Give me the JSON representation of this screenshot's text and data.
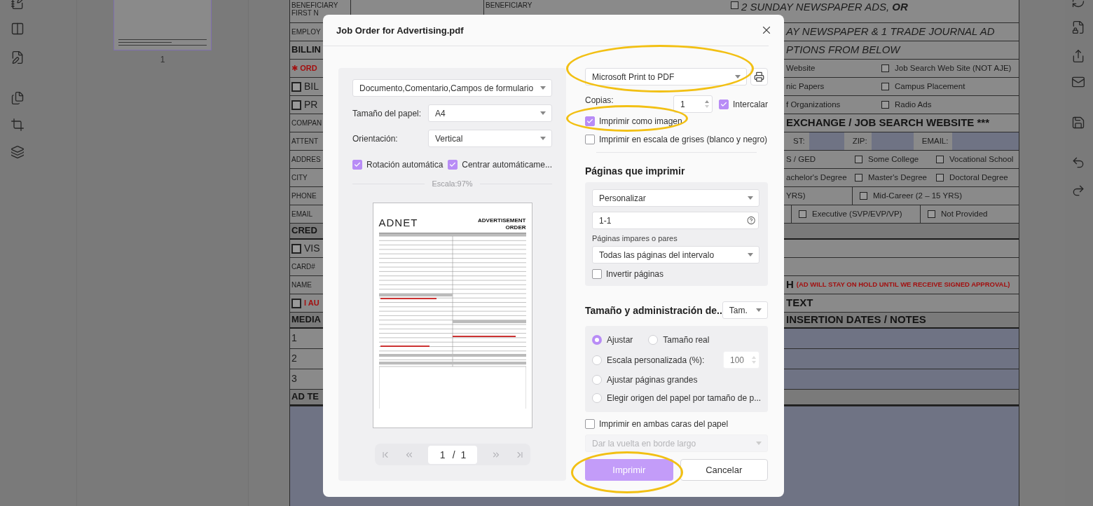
{
  "app": {
    "thumbnail_panel": {
      "page_label": "1",
      "selected": true
    },
    "document": {
      "rows": [
        {
          "kind": "top",
          "left": {
            "text": "BENEFICIARY FIRST N",
            "kind": "plain"
          },
          "middle": "BENEFICIARY",
          "right": [
            {
              "text": "2 SUNDAY NEWSPAPER ADS, **OR**",
              "kind": "italic",
              "checked": false
            }
          ]
        },
        {
          "kind": "lines",
          "left": {
            "text": "EMPLOY",
            "kind": "plain"
          },
          "right": [
            {
              "text": "AY NEWSPAPER & 1 TRADE JOURNAL AD",
              "kind": "italic"
            }
          ]
        },
        {
          "kind": "lines",
          "left": {
            "text": "BILLIN",
            "kind": "bold"
          },
          "right": [
            {
              "text": "PTIONS FROM BELOW",
              "kind": "italic"
            }
          ]
        },
        {
          "kind": "options2",
          "left": {
            "text": "✱ ORD",
            "kind": "alert"
          },
          "right": [
            {
              "text": "Website",
              "kind": "plain"
            },
            {
              "text": "Job Search Web Site (NOT AJE)",
              "kind": "plain",
              "checked": false
            }
          ]
        },
        {
          "kind": "options2",
          "left": {
            "text": "BIL",
            "kind": "large",
            "checked": false
          },
          "right": [
            {
              "text": "nic Papers",
              "kind": "plain"
            },
            {
              "text": "Campus Placement",
              "kind": "plain",
              "checked": false
            }
          ]
        },
        {
          "kind": "options2",
          "left": {
            "text": "PR",
            "kind": "large",
            "checked": false
          },
          "right": [
            {
              "text": "f Organizations",
              "kind": "plain"
            },
            {
              "text": "Radio Ads",
              "kind": "plain",
              "checked": false
            }
          ]
        },
        {
          "kind": "lines",
          "left": {
            "text": "COMPAN",
            "kind": "plain"
          },
          "right": [
            {
              "text": "EXCHANGE / JOB SEARCH WEBSITE ***",
              "kind": "bold"
            }
          ]
        },
        {
          "kind": "address",
          "left": {
            "text": "ATTENT",
            "kind": "plain"
          },
          "right": [
            {
              "text": "ST:",
              "kind": "plain"
            },
            {
              "text": "ZIP:",
              "kind": "plain"
            },
            {
              "text": "EMAIL:",
              "kind": "plain"
            }
          ]
        },
        {
          "kind": "options3",
          "left": {
            "text": "ADDRES",
            "kind": "plain"
          },
          "right": [
            {
              "text": "S / GED",
              "kind": "plain"
            },
            {
              "text": "Some College",
              "kind": "plain",
              "checked": false
            },
            {
              "text": "Vocational School",
              "kind": "plain",
              "checked": false
            }
          ]
        },
        {
          "kind": "options3",
          "left": {
            "text": "CITY",
            "kind": "plain"
          },
          "right": [
            {
              "text": "achelor's Degree",
              "kind": "plain"
            },
            {
              "text": "Master's Degree",
              "kind": "plain",
              "checked": false
            },
            {
              "text": "Doctoral Degree",
              "kind": "plain",
              "checked": false
            }
          ]
        },
        {
          "kind": "split",
          "left": {
            "text": "PHONE",
            "kind": "plain"
          },
          "right": [
            {
              "text": "YRS)",
              "kind": "plain"
            },
            {
              "text": "Mid-Career (2 – 15 YRS)",
              "kind": "plain",
              "checked": false
            }
          ]
        },
        {
          "kind": "split3",
          "left": {
            "text": "EMAIL",
            "kind": "plain"
          },
          "right": [
            {
              "text": "Executive (SVP/EVP/VP)",
              "kind": "plain",
              "checked": false
            },
            {
              "text": "Not Provided",
              "kind": "plain",
              "checked": false
            }
          ]
        },
        {
          "kind": "bar",
          "left": {
            "text": "CRED",
            "kind": "bold"
          }
        },
        {
          "kind": "lines",
          "left": {
            "text": "VIS",
            "kind": "large",
            "checked": false
          }
        },
        {
          "kind": "lines",
          "left": {
            "text": "CARD#",
            "kind": "plain"
          }
        },
        {
          "kind": "lines",
          "left": {
            "text": "NAME",
            "kind": "plain"
          },
          "right": [
            {
              "text": "H",
              "kind": "bold"
            },
            {
              "text": "(AD WILL STAY ON HOLD UNTIL WE RECEIVE SIGNED APPROVAL)",
              "kind": "alert"
            }
          ]
        },
        {
          "kind": "lines",
          "left": {
            "text": "I AU",
            "kind": "alert",
            "checked": false
          },
          "right": [
            {
              "text": "TEXT",
              "kind": "bold"
            }
          ]
        },
        {
          "kind": "bar",
          "left": {
            "text": "MEDIA",
            "kind": "bold"
          },
          "right": [
            {
              "text": "INSERTION DATES / NOTES",
              "kind": "bold"
            }
          ]
        },
        {
          "kind": "entry",
          "left": {
            "text": "1",
            "kind": "large"
          }
        },
        {
          "kind": "entry",
          "left": {
            "text": "2",
            "kind": "large"
          }
        },
        {
          "kind": "entry",
          "left": {
            "text": "3",
            "kind": "large"
          }
        },
        {
          "kind": "bar",
          "left": {
            "text": "AD TE",
            "kind": "bold"
          }
        }
      ]
    }
  },
  "dialog": {
    "title": "Job Order for Advertising.pdf",
    "content_select": "Documento,Comentario,Campos de formulario",
    "paper_size": {
      "label": "Tamaño del papel:",
      "value": "A4"
    },
    "orientation": {
      "label": "Orientación:",
      "value": "Vertical"
    },
    "layout_options": [
      {
        "label": "Rotación automática",
        "checked": true
      },
      {
        "label": "Centrar automáticame...",
        "checked": true
      }
    ],
    "scale_label": "Escala:97%",
    "preview": {
      "logo": "ADNET",
      "title": "ADVERTISEMENT ORDER"
    },
    "pager": {
      "current": "1",
      "separator": "/",
      "total": "1"
    },
    "printer": "Microsoft Print to PDF",
    "copies": {
      "label": "Copias:",
      "value": "1"
    },
    "collate": {
      "label": "Intercalar",
      "checked": true
    },
    "print_options": [
      {
        "label": "Imprimir como imagen",
        "checked": true
      },
      {
        "label": "Imprimir en escala de grises (blanco y negro)",
        "checked": false
      }
    ],
    "pages": {
      "heading": "Páginas que imprimir",
      "mode": "Personalizar",
      "range": "1-1",
      "parity_label": "Páginas impares o pares",
      "parity": "Todas las páginas del intervalo",
      "reverse": {
        "label": "Invertir páginas",
        "checked": false
      }
    },
    "sizing": {
      "heading": "Tamaño y administración de..",
      "mode": "Tam.",
      "options": [
        {
          "label": "Ajustar",
          "selected": true
        },
        {
          "label": "Tamaño real",
          "selected": false
        },
        {
          "label": "Escala personalizada (%):",
          "selected": false,
          "placeholder": "100"
        },
        {
          "label": "Ajustar páginas grandes",
          "selected": false
        },
        {
          "label": "Elegir origen del papel por tamaño de p...",
          "selected": false
        }
      ]
    },
    "duplex": {
      "label": "Imprimir en ambas caras del papel",
      "checked": false,
      "flip": "Dar la vuelta en borde largo",
      "disabled": true
    },
    "buttons": [
      {
        "label": "Imprimir",
        "kind": "primary"
      },
      {
        "label": "Cancelar",
        "kind": "secondary"
      }
    ]
  }
}
